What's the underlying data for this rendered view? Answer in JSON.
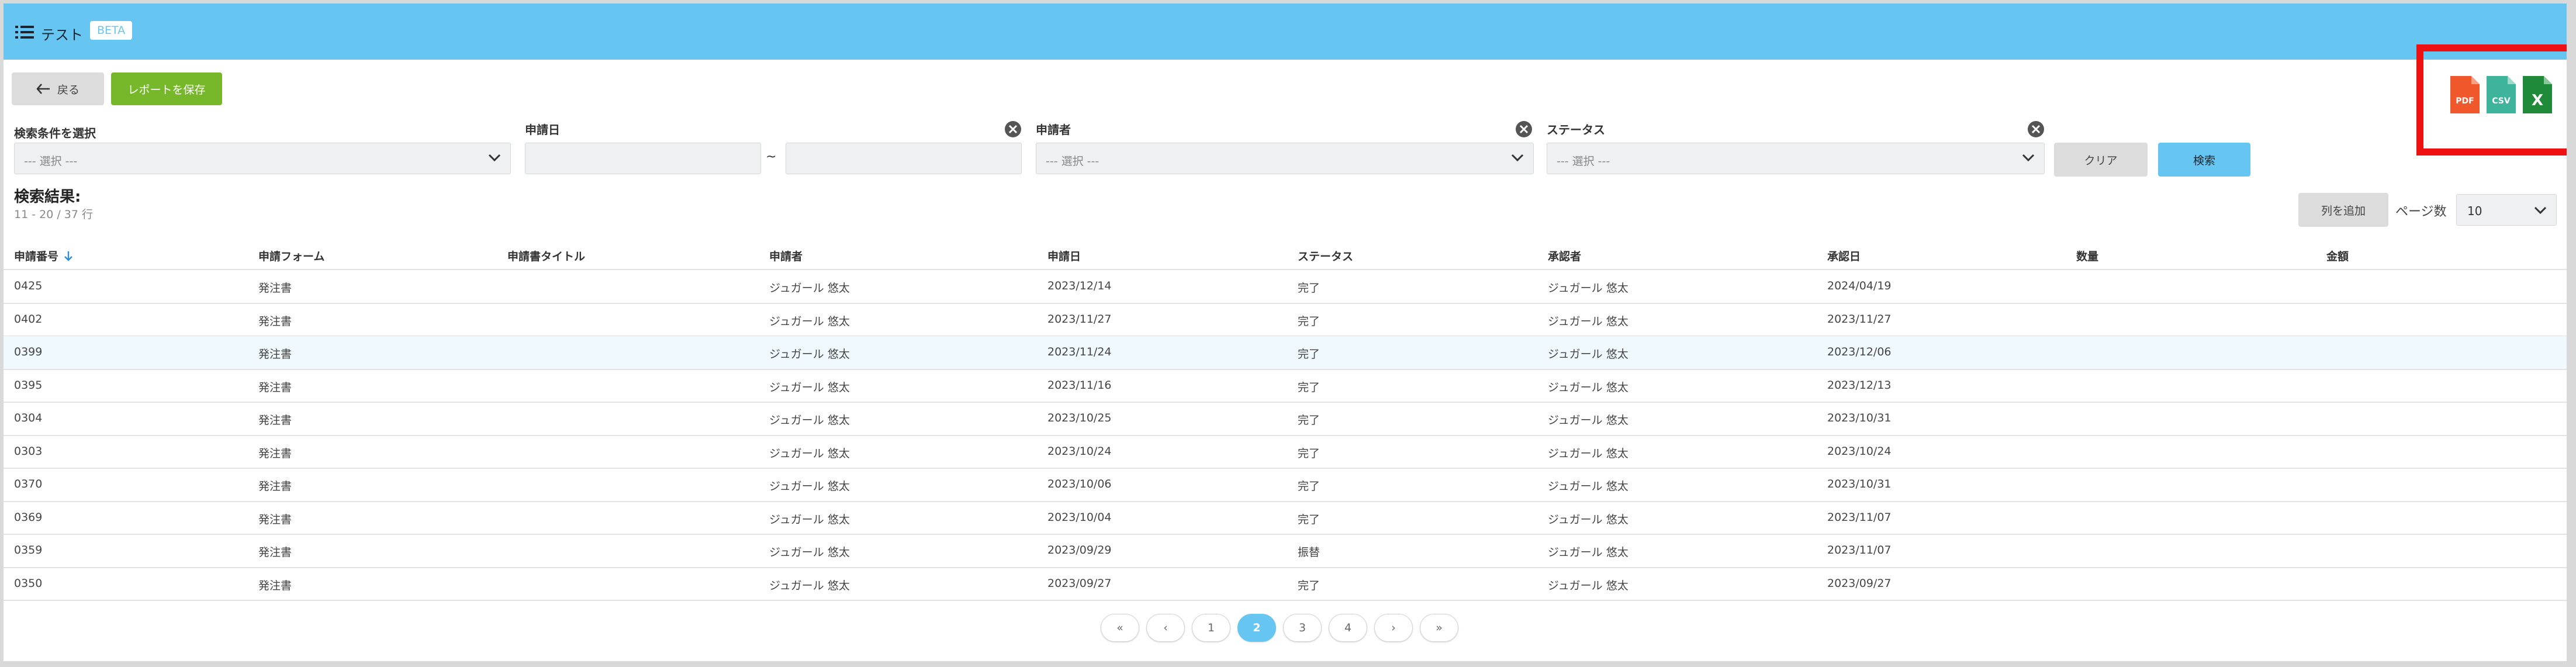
{
  "header": {
    "title": "テスト",
    "badge": "BETA"
  },
  "toolbar": {
    "back_label": "戻る",
    "save_report_label": "レポートを保存"
  },
  "exports": [
    {
      "label": "PDF",
      "color": "#f0582b"
    },
    {
      "label": "CSV",
      "color": "#3eb49c"
    },
    {
      "label": "X",
      "color": "#1f8a3a"
    }
  ],
  "filters": {
    "condition": {
      "label": "検索条件を選択",
      "value": "--- 選択 ---"
    },
    "date": {
      "label": "申請日",
      "from": "",
      "to": "",
      "separator": "~"
    },
    "applicant": {
      "label": "申請者",
      "value": "--- 選択 ---"
    },
    "status": {
      "label": "ステータス",
      "value": "--- 選択 ---"
    },
    "clear_label": "クリア",
    "search_label": "検索"
  },
  "results": {
    "title": "検索結果:",
    "range_text": "11 - 20 / 37 行",
    "add_column_label": "列を追加",
    "per_page_label": "ページ数",
    "per_page_value": "10"
  },
  "table": {
    "columns": [
      "申請番号",
      "申請フォーム",
      "申請書タイトル",
      "申請者",
      "申請日",
      "ステータス",
      "承認者",
      "承認日",
      "数量",
      "金額"
    ],
    "rows": [
      [
        "0425",
        "発注書",
        "",
        "ジュガール 悠太",
        "2023/12/14",
        "完了",
        "ジュガール 悠太",
        "2024/04/19",
        "",
        ""
      ],
      [
        "0402",
        "発注書",
        "",
        "ジュガール 悠太",
        "2023/11/27",
        "完了",
        "ジュガール 悠太",
        "2023/11/27",
        "",
        ""
      ],
      [
        "0399",
        "発注書",
        "",
        "ジュガール 悠太",
        "2023/11/24",
        "完了",
        "ジュガール 悠太",
        "2023/12/06",
        "",
        ""
      ],
      [
        "0395",
        "発注書",
        "",
        "ジュガール 悠太",
        "2023/11/16",
        "完了",
        "ジュガール 悠太",
        "2023/12/13",
        "",
        ""
      ],
      [
        "0304",
        "発注書",
        "",
        "ジュガール 悠太",
        "2023/10/25",
        "完了",
        "ジュガール 悠太",
        "2023/10/31",
        "",
        ""
      ],
      [
        "0303",
        "発注書",
        "",
        "ジュガール 悠太",
        "2023/10/24",
        "完了",
        "ジュガール 悠太",
        "2023/10/24",
        "",
        ""
      ],
      [
        "0370",
        "発注書",
        "",
        "ジュガール 悠太",
        "2023/10/06",
        "完了",
        "ジュガール 悠太",
        "2023/10/31",
        "",
        ""
      ],
      [
        "0369",
        "発注書",
        "",
        "ジュガール 悠太",
        "2023/10/04",
        "完了",
        "ジュガール 悠太",
        "2023/11/07",
        "",
        ""
      ],
      [
        "0359",
        "発注書",
        "",
        "ジュガール 悠太",
        "2023/09/29",
        "振替",
        "ジュガール 悠太",
        "2023/11/07",
        "",
        ""
      ],
      [
        "0350",
        "発注書",
        "",
        "ジュガール 悠太",
        "2023/09/27",
        "完了",
        "ジュガール 悠太",
        "2023/09/27",
        "",
        ""
      ]
    ]
  },
  "pagination": {
    "first": "«",
    "prev": "‹",
    "pages": [
      "1",
      "2",
      "3",
      "4"
    ],
    "current": "2",
    "next": "›",
    "last": "»"
  }
}
